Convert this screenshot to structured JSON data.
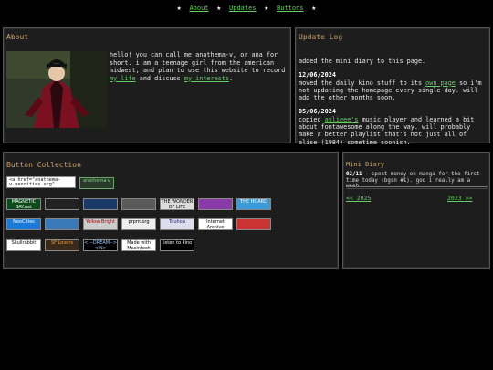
{
  "nav": {
    "star": "★",
    "links": [
      "About",
      "Updates",
      "Buttons"
    ]
  },
  "about": {
    "title": "About",
    "text_before": "hello! you can call me anathema-v, or ana for short. i am a teenage girl from the american midwest, and plan to use this website to record ",
    "link1": "my life",
    "text_mid": " and discuss ",
    "link2": "my interests",
    "text_end": "."
  },
  "update_log": {
    "title": "Update Log",
    "intro": "added the mini diary to this page.",
    "entries": [
      {
        "date": "12/06/2024",
        "before": "moved the daily kino stuff to its ",
        "link": "own page",
        "after": " so i'm not updating the homepage every single day. will add the other months soon."
      },
      {
        "date": "05/06/2024",
        "before": "copied ",
        "link": "aslieee's",
        "after": " music player and learned a bit about fontawesome along the way. will probably make a better playlist that's not just all of alise (1984) sometime soonish."
      }
    ]
  },
  "button_collection": {
    "title": "Button Collection",
    "code_snippet": "<a href=\"anathema-v.neocities.org\"",
    "own_badge": "anathema-v",
    "badges": [
      {
        "text": "MAGNETIC BAY.net",
        "bg": "#0d4a1a",
        "fg": "#fff"
      },
      {
        "text": "",
        "bg": "#222",
        "fg": "#fff"
      },
      {
        "text": "",
        "bg": "#1a3a6a",
        "fg": "#fff"
      },
      {
        "text": "",
        "bg": "#5a5a5a",
        "fg": "#fff"
      },
      {
        "text": "THE WONDER OF LIFE",
        "bg": "#ddd",
        "fg": "#000"
      },
      {
        "text": "",
        "bg": "#8a3aa8",
        "fg": "#fff"
      },
      {
        "text": "THE HOARD",
        "bg": "#3a9ad8",
        "fg": "#fff"
      },
      {
        "text": "NeoCities",
        "bg": "#1a7ad8",
        "fg": "#fff"
      },
      {
        "text": "",
        "bg": "#3a7ab8",
        "fg": "#fff"
      },
      {
        "text": "Yellow Bright",
        "bg": "#ccc",
        "fg": "#a00"
      },
      {
        "text": "prpm.org",
        "bg": "#eee",
        "fg": "#000"
      },
      {
        "text": "Touhou",
        "bg": "#dde",
        "fg": "#226"
      },
      {
        "text": "Internet Archive",
        "bg": "#fff",
        "fg": "#000"
      },
      {
        "text": "",
        "bg": "#c33",
        "fg": "#fff"
      },
      {
        "text": "Skullrabbit",
        "bg": "#fff",
        "fg": "#000"
      },
      {
        "text": "SF Lovers",
        "bg": "#3a2a1a",
        "fg": "#e8a040"
      },
      {
        "text": "<!--DREAM--> <IN> <HTML>",
        "bg": "#000",
        "fg": "#9cf"
      },
      {
        "text": "Made with Macintosh",
        "bg": "#fff",
        "fg": "#000"
      },
      {
        "text": "listen to kino",
        "bg": "#000",
        "fg": "#fff"
      }
    ]
  },
  "mini_diary": {
    "title": "Mini Diary",
    "date": "02/11",
    "text": " - spent money on manga for the first time today (bgsn #1). god i really am a weeb.",
    "prev": "<< 2025",
    "next": "2023 >>"
  },
  "colors": {
    "link": "#5ed05e",
    "heading": "#c9a467",
    "panel_bg": "#1d1d1d",
    "page_bg": "#000000"
  }
}
